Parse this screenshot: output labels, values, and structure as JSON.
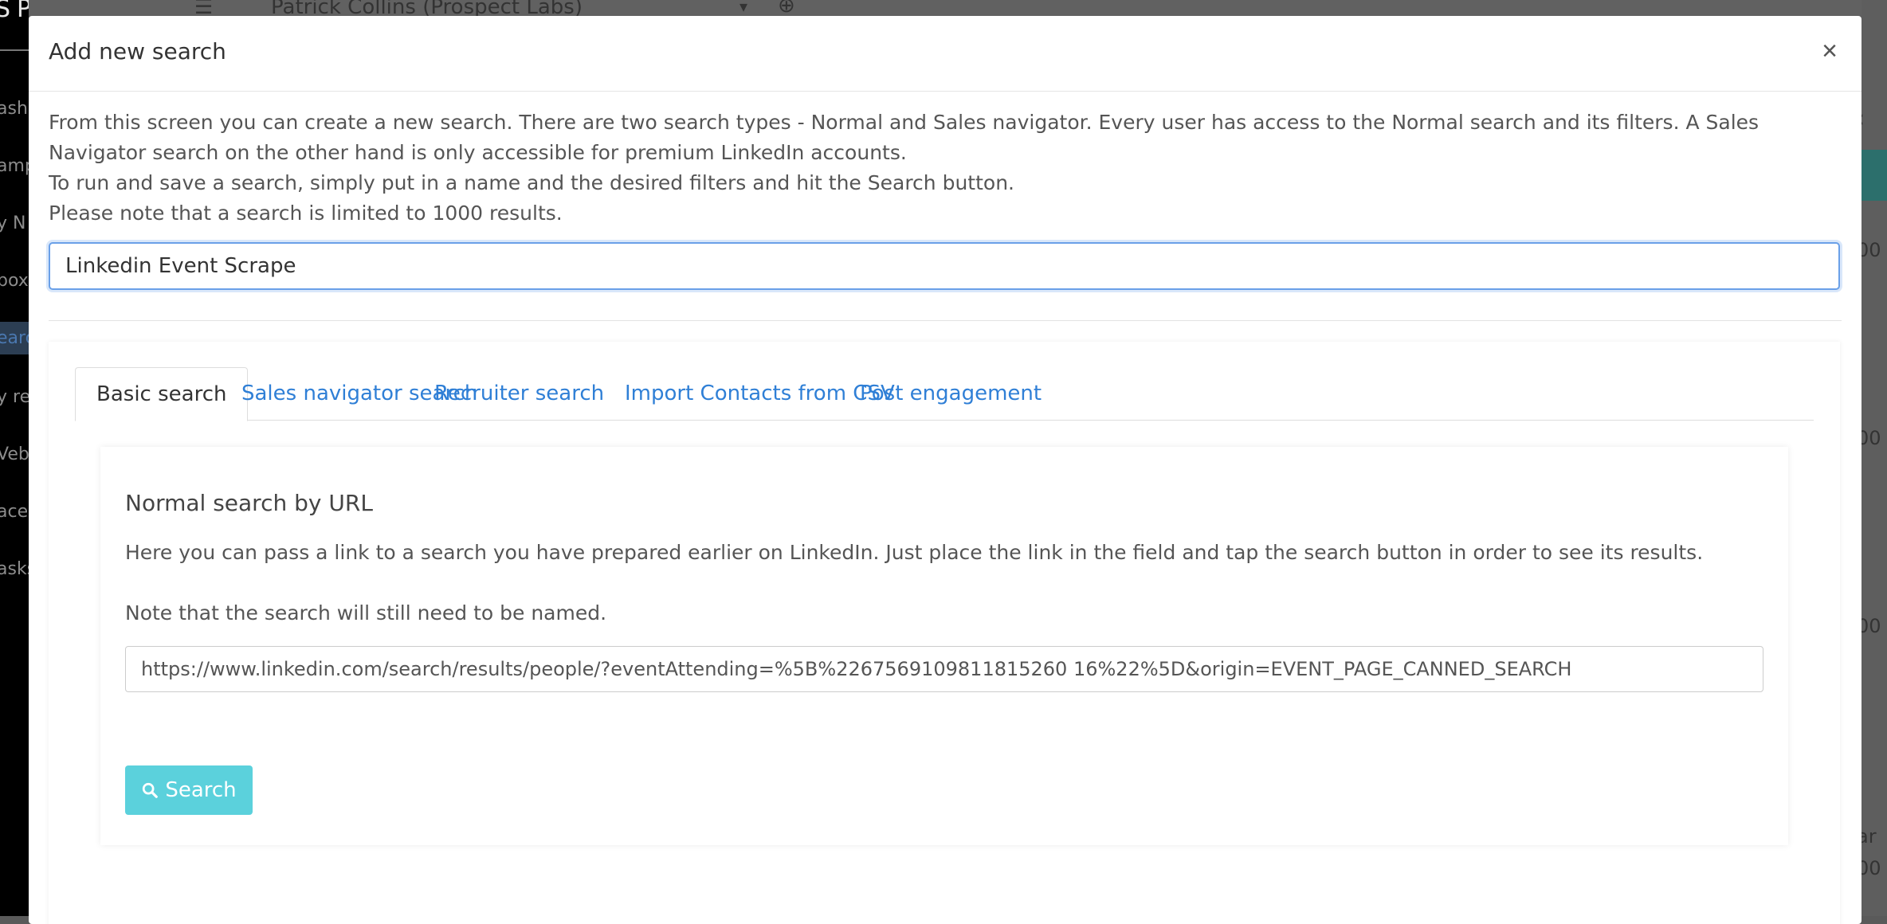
{
  "background": {
    "brand": "SPECT LABS",
    "account_name": "Patrick Collins (Prospect Labs)",
    "sidebar_fragments": [
      "ash",
      "amp",
      "y N",
      "box",
      "earc",
      "y re",
      "Veb",
      "ace",
      "asks"
    ],
    "right_fragments": [
      "00",
      "00",
      "00",
      "ar",
      "00"
    ]
  },
  "modal": {
    "title": "Add new search",
    "close_label": "×",
    "intro": [
      "From this screen you can create a new search. There are two search types - Normal and Sales navigator. Every user has access to the Normal search and its filters. A Sales Navigator search on the other hand is only accessible for premium LinkedIn accounts.",
      "To run and save a search, simply put in a name and the desired filters and hit the Search button.",
      "Please note that a search is limited to 1000 results."
    ],
    "search_name_value": "Linkedin Event Scrape"
  },
  "tabs": [
    {
      "label": "Basic search",
      "active": true
    },
    {
      "label": "Sales navigator search",
      "active": false
    },
    {
      "label": "Recruiter search",
      "active": false
    },
    {
      "label": "Import Contacts from CSV",
      "active": false
    },
    {
      "label": "Post engagement",
      "active": false
    }
  ],
  "basic_search": {
    "title": "Normal search by URL",
    "description": "Here you can pass a link to a search you have prepared earlier on LinkedIn. Just place the link in the field and tap the search button in order to see its results.",
    "note": "Note that the search will still need to be named.",
    "url_value": "https://www.linkedin.com/search/results/people/?eventAttending=%5B%2267569109811815260 16%22%5D&origin=EVENT_PAGE_CANNED_SEARCH",
    "search_button_label": "Search",
    "search_icon": "search-icon"
  },
  "colors": {
    "link": "#2f7fd6",
    "search_button": "#5bd1dc",
    "input_focus_border": "#6aa0e8"
  }
}
